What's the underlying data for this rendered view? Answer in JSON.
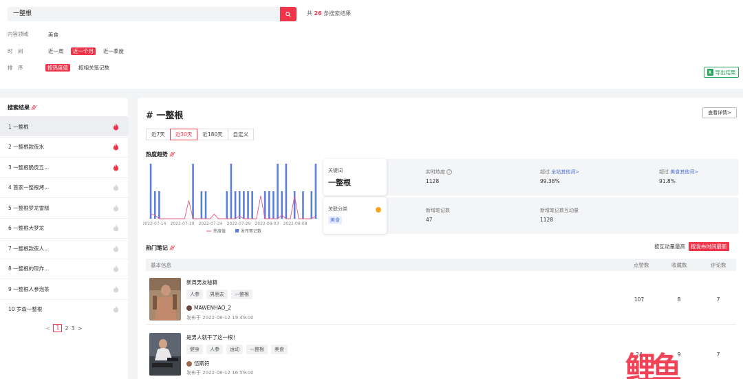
{
  "search": {
    "value": "一整根",
    "result_prefix": "共",
    "result_count": "26",
    "result_suffix": "条搜索结果"
  },
  "filters": {
    "domain_label": "内容领域",
    "domain_value": "美食",
    "time_label": "时　间",
    "time_options": [
      "近一周",
      "近一个月",
      "近一季度"
    ],
    "time_selected": "近一个月",
    "sort_label": "排　序",
    "sort_options": [
      "按热度值",
      "按相关笔记数"
    ],
    "sort_selected": "按热度值",
    "export_label": "导出结果",
    "export_icon": "excel-icon"
  },
  "left": {
    "title": "搜索结果",
    "items": [
      {
        "label": "1  一整根",
        "hot": true
      },
      {
        "label": "2  一整根款夜水",
        "hot": true
      },
      {
        "label": "3  一整根脆皮五...",
        "hot": true
      },
      {
        "label": "4  首家一整根烤...",
        "hot": false
      },
      {
        "label": "5  一整根梦龙雪糕",
        "hot": false
      },
      {
        "label": "6  一整根大梦龙",
        "hot": false
      },
      {
        "label": "7  一整根款夜人...",
        "hot": false
      },
      {
        "label": "8  一整根的现炸...",
        "hot": false
      },
      {
        "label": "9  一整根人参泡茶",
        "hot": false
      },
      {
        "label": "10  罗森一整根",
        "hot": false
      }
    ],
    "pager": {
      "prev": "<",
      "pages": [
        "1",
        "2",
        "3"
      ],
      "current": "1",
      "next": ">"
    },
    "colors": {
      "hot": "#f0344a",
      "cold": "#d8d8d8"
    }
  },
  "main": {
    "title": "# 一整根",
    "detail_button": "查看详情>",
    "period_tabs": [
      "近7天",
      "近30天",
      "近180天",
      "自定义"
    ],
    "period_selected": "近30天",
    "trend_title": "热度趋势",
    "keyword_card": {
      "label": "关键词",
      "value": "一整根",
      "realtime_label": "实时热度",
      "realtime_value": "1128",
      "exceed_label_a": "超过",
      "exceed_link_a": "全站其他词>",
      "exceed_value_a": "99.38%",
      "exceed_label_b": "超过",
      "exceed_link_b": "美食其他词>",
      "exceed_value_b": "91.8%"
    },
    "category_card": {
      "label": "关联分类",
      "tag": "美食",
      "new_notes_label": "新增笔记数",
      "new_notes_value": "47",
      "interaction_label": "新增笔记数互动量",
      "interaction_value": "1128"
    },
    "hot_notes_title": "热门笔记",
    "sort_options": [
      "按互动量最高",
      "按发布时间最新"
    ],
    "sort_selected": "按发布时间最新",
    "table_headers": [
      "基本信息",
      "点赞数",
      "收藏数",
      "评论数"
    ],
    "notes": [
      {
        "title": "新周男友秘籍",
        "tags": [
          "人参",
          "男朋友",
          "一整根"
        ],
        "author": "MAWENHAO_2",
        "published": "发布于 2022-08-12 19:49:00",
        "likes": "107",
        "collects": "8",
        "comments": "7"
      },
      {
        "title": "是男人就干了这一根！",
        "tags": [
          "健身",
          "人参",
          "运动",
          "一整根",
          "美食"
        ],
        "author": "伍斯符",
        "published": "发布于 2022-08-12 16:59:00",
        "likes": "24",
        "collects": "9",
        "comments": "7"
      }
    ]
  },
  "chart_data": {
    "type": "bar",
    "categories": [
      "2022-07-14",
      "2022-07-19",
      "2022-07-24",
      "2022-07-29",
      "2022-08-03",
      "2022-08-08"
    ],
    "x_ticks": [
      "2022-07-14",
      "2022-07-19",
      "2022-07-24",
      "2022-07-29",
      "2022-08-03",
      "2022-08-08"
    ],
    "series": [
      {
        "name": "热度值",
        "kind": "line",
        "color": "#e2577a",
        "values": [
          0.5,
          0.4,
          0,
          0,
          0,
          0,
          0,
          0,
          0,
          2,
          0,
          0,
          0,
          0,
          0,
          0.5,
          0,
          0,
          0,
          0,
          0,
          0.3,
          0,
          0,
          0,
          0,
          2.5,
          0,
          0,
          0,
          0,
          0.4,
          0,
          0,
          2.5,
          0,
          0,
          0,
          0,
          0.3
        ]
      },
      {
        "name": "发布笔记数",
        "kind": "bar",
        "color": "#5b7fe0",
        "values": [
          6,
          3,
          3,
          0,
          0,
          0,
          0,
          0,
          0,
          0,
          6,
          0,
          3,
          3,
          0,
          0,
          0,
          0,
          3,
          6,
          3,
          3,
          3,
          3,
          3,
          0,
          0,
          3,
          3,
          3,
          6,
          3,
          6,
          0,
          3,
          0,
          3,
          0,
          3,
          6
        ]
      }
    ],
    "ylim": [
      0,
      6
    ],
    "legend": "bottom"
  },
  "watermark": {
    "text": "鲤鱼",
    "brand_color": "#f0344a"
  }
}
